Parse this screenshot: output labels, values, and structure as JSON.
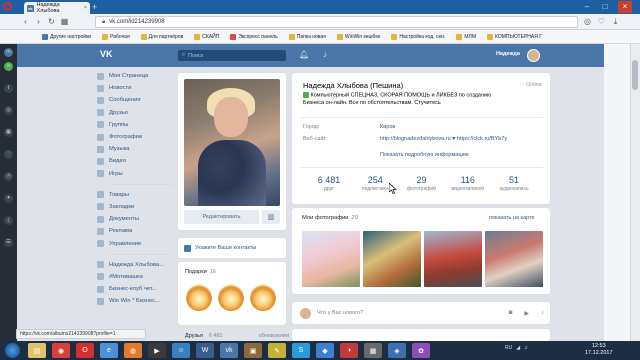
{
  "browser": {
    "tab_title": "Надежда Хлыбова",
    "url": "vk.com/id214239908",
    "bookmarks": [
      {
        "label": "Другие настройки",
        "color": "#4a76a8"
      },
      {
        "label": "Рабочая",
        "color": "#e6b53a"
      },
      {
        "label": "Для партнёров",
        "color": "#e6b53a"
      },
      {
        "label": "СКАЙП",
        "color": "#e6b53a"
      },
      {
        "label": "Экспресс панель",
        "color": "#d94b4b"
      },
      {
        "label": "Папка новая",
        "color": "#e6b53a"
      },
      {
        "label": "WinWin кешбек",
        "color": "#e6b53a"
      },
      {
        "label": "Настройка код. сен.",
        "color": "#e6b53a"
      },
      {
        "label": "МЛМ",
        "color": "#e6b53a"
      },
      {
        "label": "КОМПЬЮТЕРНАЯ Г",
        "color": "#e6b53a"
      }
    ],
    "status_url": "https://vk.com/albums214239908?profile=1"
  },
  "vk": {
    "search_placeholder": "Поиск",
    "header_user": "Надежда",
    "menu": [
      "Моя Страница",
      "Новости",
      "Сообщения",
      "Друзья",
      "Группы",
      "Фотографии",
      "Музыка",
      "Видео",
      "Игры"
    ],
    "menu2": [
      "Товары",
      "Закладки",
      "Документы",
      "Реклама",
      "Управление"
    ],
    "menu3": [
      "Надежда Хлыбова...",
      "#Мотивашка",
      "Бизнес-клуб чет...",
      "Win Win * Бизнес..."
    ],
    "edit_button": "Редактировать",
    "contacts_label": "Укажите Ваши контакты",
    "gifts_label": "Подарки",
    "gifts_count": "16",
    "friends_label": "Друзья",
    "friends_count": "6 481",
    "friends_updates": "обновления",
    "profile_name": "Надежда Хлыбова (Пешина)",
    "online": "Online",
    "status_line1": "Компьютерный СПЕЦНАЗ, СКОРАЯ ПОМОЩЬ и ЛИКБЕЗ по созданию",
    "status_line2": "Бизнеса он-лайн. Все по обстоятельствам. Стучитесь",
    "city_label": "Город:",
    "city_value": "Киров",
    "site_label": "Веб-сайт:",
    "site_value": "http://blognadezdahlybova.ru ♥ https://clck.ru/BYb7y",
    "show_more": "Показать подробную информацию",
    "counters": [
      {
        "num": "6 481",
        "label": "друг"
      },
      {
        "num": "254",
        "label": "подписчика"
      },
      {
        "num": "29",
        "label": "фотографий"
      },
      {
        "num": "116",
        "label": "видеозаписей"
      },
      {
        "num": "51",
        "label": "аудиозапись"
      }
    ],
    "photos_label": "Мои фотографии",
    "photos_count": "29",
    "photos_map": "показать на карте",
    "post_placeholder": "Что у Вас нового?"
  },
  "taskbar": {
    "lang": "RU",
    "time": "12:53",
    "date": "17.12.2017"
  }
}
